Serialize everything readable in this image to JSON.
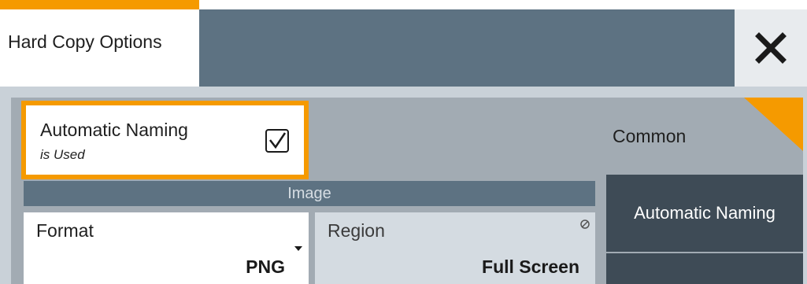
{
  "window": {
    "title": "Hard Copy Options",
    "close_label": "close"
  },
  "automatic_naming": {
    "label": "Automatic Naming",
    "sublabel": "is Used",
    "checked": true
  },
  "sidebar": {
    "items": [
      {
        "label": "Common",
        "selected": false
      },
      {
        "label": "Automatic Naming",
        "selected": false
      },
      {
        "label": "",
        "selected": false
      }
    ]
  },
  "image_section": {
    "header": "Image",
    "format": {
      "label": "Format",
      "value": "PNG"
    },
    "region": {
      "label": "Region",
      "value": "Full Screen",
      "read_only": true
    }
  },
  "colors": {
    "accent": "#f59a00",
    "title_bar": "#5d7282",
    "panel": "#a2abb3",
    "sidebar_dark": "#3e4b56"
  },
  "icons": [
    "close-icon",
    "checkbox-checked-icon",
    "dropdown-caret-icon",
    "read-only-icon"
  ]
}
